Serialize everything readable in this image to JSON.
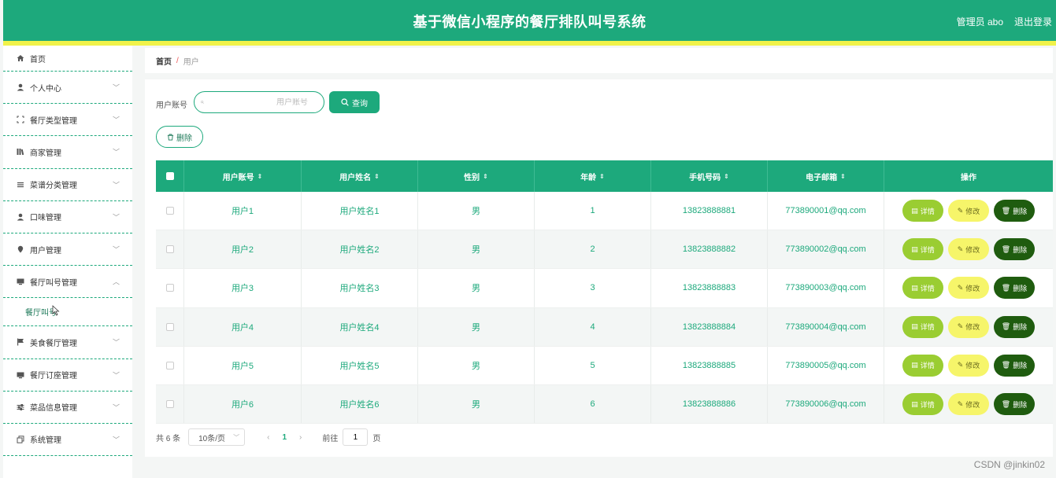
{
  "header": {
    "title": "基于微信小程序的餐厅排队叫号系统",
    "admin": "管理员 abo",
    "logout": "退出登录"
  },
  "sidebar": {
    "home": "首页",
    "items": [
      {
        "label": "个人中心",
        "icon": "person-icon"
      },
      {
        "label": "餐厅类型管理",
        "icon": "expand-icon"
      },
      {
        "label": "商家管理",
        "icon": "books-icon"
      },
      {
        "label": "菜谱分类管理",
        "icon": "list-icon"
      },
      {
        "label": "口味管理",
        "icon": "person-icon"
      },
      {
        "label": "用户管理",
        "icon": "pin-icon"
      },
      {
        "label": "餐厅叫号管理",
        "icon": "monitor-icon"
      },
      {
        "label": "美食餐厅管理",
        "icon": "flag-icon"
      },
      {
        "label": "餐厅订座管理",
        "icon": "monitor-icon"
      },
      {
        "label": "菜品信息管理",
        "icon": "sliders-icon"
      },
      {
        "label": "系统管理",
        "icon": "copy-icon"
      }
    ],
    "submenu_label": "餐厅叫号"
  },
  "breadcrumb": {
    "home": "首页",
    "separator": "/",
    "current": "用户"
  },
  "search": {
    "label": "用户账号",
    "placeholder": "用户账号",
    "query_button": "查询"
  },
  "toolbar": {
    "delete_button": "删除"
  },
  "table": {
    "columns": [
      "用户账号",
      "用户姓名",
      "性别",
      "年龄",
      "手机号码",
      "电子邮箱",
      "操作"
    ],
    "rows": [
      {
        "account": "用户1",
        "name": "用户姓名1",
        "gender": "男",
        "age": "1",
        "phone": "13823888881",
        "email": "773890001@qq.com"
      },
      {
        "account": "用户2",
        "name": "用户姓名2",
        "gender": "男",
        "age": "2",
        "phone": "13823888882",
        "email": "773890002@qq.com"
      },
      {
        "account": "用户3",
        "name": "用户姓名3",
        "gender": "男",
        "age": "3",
        "phone": "13823888883",
        "email": "773890003@qq.com"
      },
      {
        "account": "用户4",
        "name": "用户姓名4",
        "gender": "男",
        "age": "4",
        "phone": "13823888884",
        "email": "773890004@qq.com"
      },
      {
        "account": "用户5",
        "name": "用户姓名5",
        "gender": "男",
        "age": "5",
        "phone": "13823888885",
        "email": "773890005@qq.com"
      },
      {
        "account": "用户6",
        "name": "用户姓名6",
        "gender": "男",
        "age": "6",
        "phone": "13823888886",
        "email": "773890006@qq.com"
      }
    ],
    "actions": {
      "detail": "详情",
      "edit": "修改",
      "delete": "删除"
    }
  },
  "pager": {
    "total": "共 6 条",
    "page_size": "10条/页",
    "current_page": "1",
    "goto_label": "前往",
    "goto_value": "1",
    "page_suffix": "页"
  },
  "watermark": "CSDN @jinkin02",
  "colors": {
    "primary": "#1da97c",
    "accent_bar": "#f0f24a",
    "detail": "#9acd32",
    "edit": "#f6f56a",
    "delete": "#1f5c0f"
  }
}
